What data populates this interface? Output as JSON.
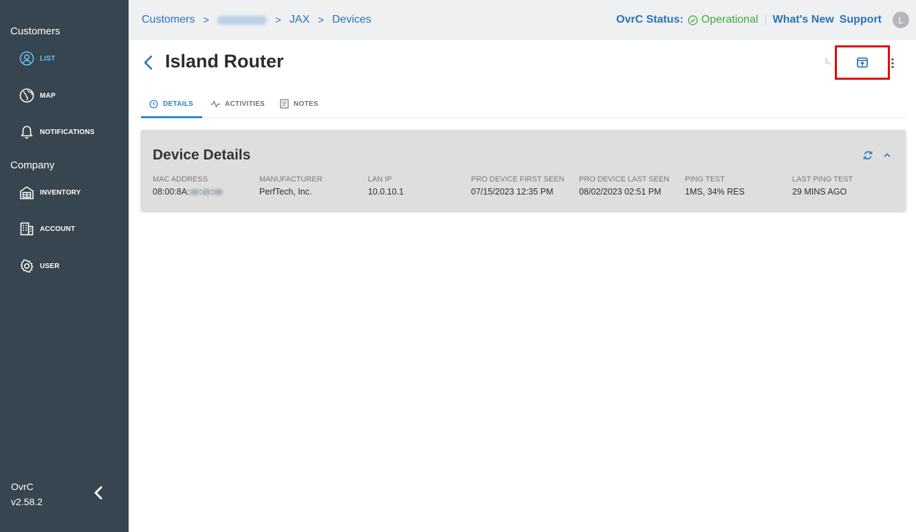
{
  "sidebar": {
    "section_customers": "Customers",
    "section_company": "Company",
    "items": [
      {
        "label": "LIST",
        "icon": "person-circle-icon",
        "active": true
      },
      {
        "label": "MAP",
        "icon": "globe-icon",
        "active": false
      },
      {
        "label": "NOTIFICATIONS",
        "icon": "bell-icon",
        "active": false
      },
      {
        "label": "INVENTORY",
        "icon": "inventory-box-icon",
        "active": false
      },
      {
        "label": "ACCOUNT",
        "icon": "building-icon",
        "active": false
      },
      {
        "label": "USER",
        "icon": "gear-icon",
        "active": false
      }
    ],
    "app_name": "OvrC",
    "version": "v2.58.2"
  },
  "header": {
    "breadcrumb": {
      "customers": "Customers",
      "site": "JAX",
      "devices": "Devices"
    },
    "status_label": "OvrC Status:",
    "status_value": "Operational",
    "whats_new": "What's New",
    "support": "Support",
    "avatar_initial": "L"
  },
  "page": {
    "title": "Island Router"
  },
  "tabs": [
    {
      "label": "DETAILS",
      "icon": "clock-icon",
      "active": true
    },
    {
      "label": "ACTIVITIES",
      "icon": "activity-icon",
      "active": false
    },
    {
      "label": "NOTES",
      "icon": "notes-icon",
      "active": false
    }
  ],
  "device_details": {
    "title": "Device Details",
    "fields": {
      "mac_label": "MAC ADDRESS",
      "mac_value": "08:00:8A:",
      "manufacturer_label": "MANUFACTURER",
      "manufacturer_value": "PerfTech, Inc.",
      "lan_ip_label": "LAN IP",
      "lan_ip_value": "10.0.10.1",
      "first_seen_label": "PRO DEVICE FIRST SEEN",
      "first_seen_value": "07/15/2023 12:35 PM",
      "last_seen_label": "PRO DEVICE LAST SEEN",
      "last_seen_value": "08/02/2023 02:51 PM",
      "ping_label": "PING TEST",
      "ping_value": "1MS, 34% RES",
      "last_ping_label": "LAST PING TEST",
      "last_ping_value": "29 MINS AGO"
    }
  },
  "colors": {
    "sidebar_bg": "#36454f",
    "accent": "#2a73b5",
    "active_nav": "#6ac1f5",
    "status_ok": "#3ea83e",
    "highlight": "#e50000"
  }
}
